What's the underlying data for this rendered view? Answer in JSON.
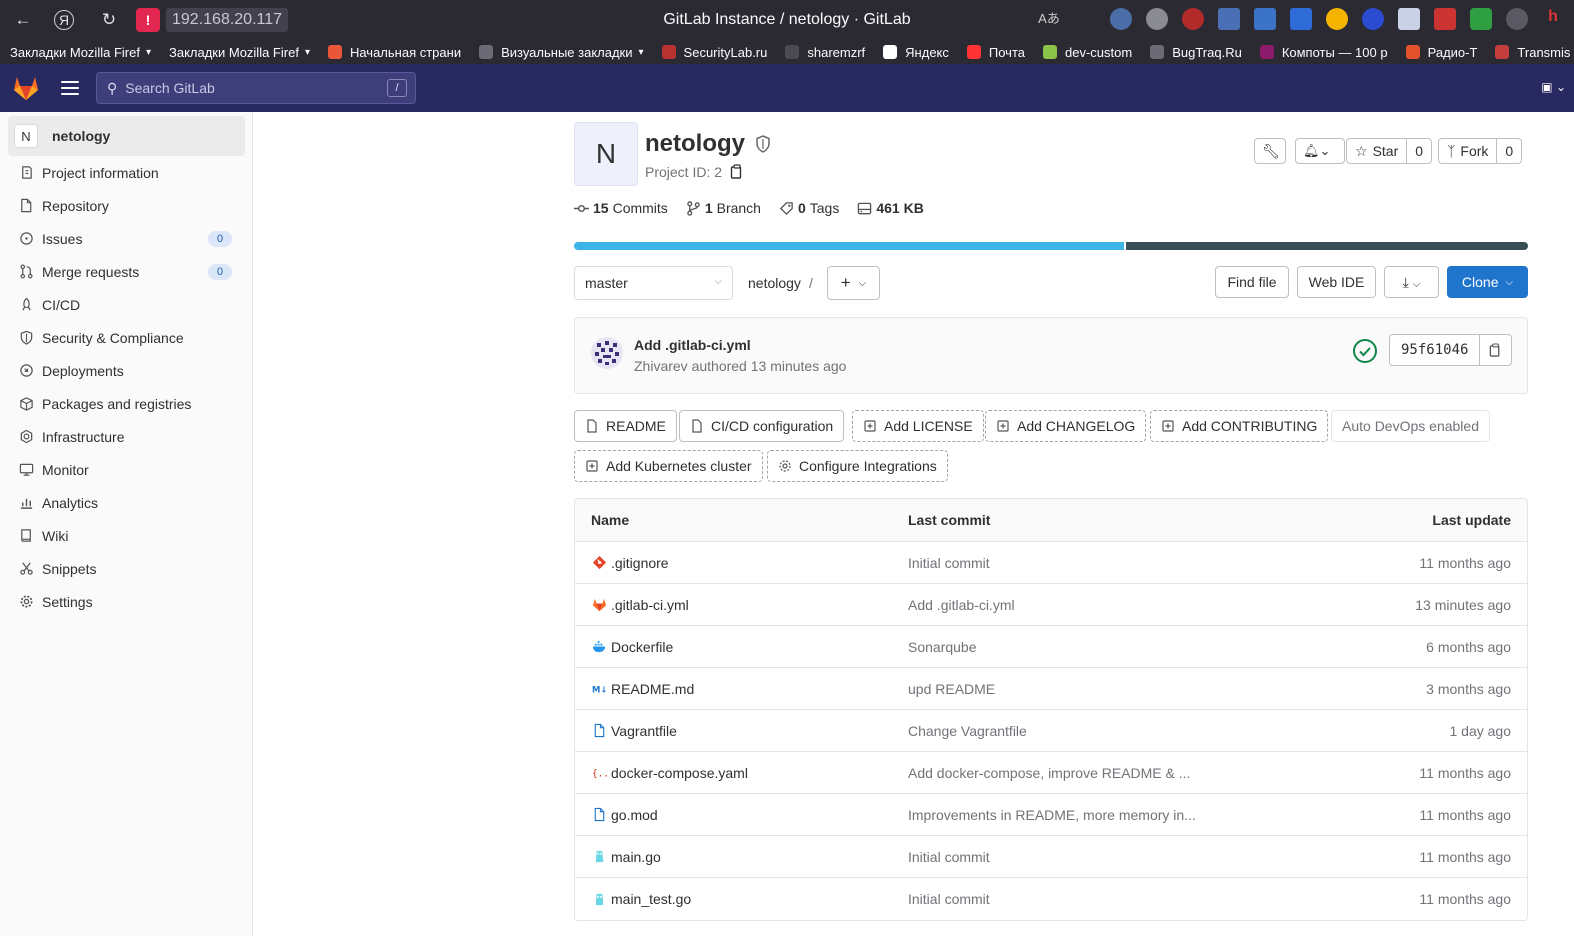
{
  "browser": {
    "url": "192.168.20.117",
    "window_title": "GitLab Instance / netology · GitLab",
    "bookmarks": [
      "Закладки Mozilla Firef",
      "Закладки Mozilla Firef",
      "Начальная страни",
      "Визуальные закладки",
      "SecurityLab.ru",
      "sharemzrf",
      "Яндекс",
      "Почта",
      "dev-custom",
      "BugTraq.Ru",
      "Компоты — 100 р",
      "Радио-Т",
      "Transmis"
    ]
  },
  "header": {
    "search_placeholder": "Search GitLab",
    "search_shortcut": "/"
  },
  "sidebar": {
    "project_letter": "N",
    "project_name": "netology",
    "items": [
      {
        "label": "Project information",
        "icon": "info-icon"
      },
      {
        "label": "Repository",
        "icon": "doc-icon"
      },
      {
        "label": "Issues",
        "icon": "issues-icon",
        "badge": "0"
      },
      {
        "label": "Merge requests",
        "icon": "merge-icon",
        "badge": "0"
      },
      {
        "label": "CI/CD",
        "icon": "rocket-icon"
      },
      {
        "label": "Security & Compliance",
        "icon": "shield-icon"
      },
      {
        "label": "Deployments",
        "icon": "deploy-icon"
      },
      {
        "label": "Packages and registries",
        "icon": "package-icon"
      },
      {
        "label": "Infrastructure",
        "icon": "infra-icon"
      },
      {
        "label": "Monitor",
        "icon": "monitor-icon"
      },
      {
        "label": "Analytics",
        "icon": "chart-icon"
      },
      {
        "label": "Wiki",
        "icon": "book-icon"
      },
      {
        "label": "Snippets",
        "icon": "scissors-icon"
      },
      {
        "label": "Settings",
        "icon": "gear-icon"
      }
    ]
  },
  "project": {
    "letter": "N",
    "name": "netology",
    "id_label": "Project ID: 2",
    "stats": {
      "commits_count": "15",
      "commits_label": "Commits",
      "branches_count": "1",
      "branches_label": "Branch",
      "tags_count": "0",
      "tags_label": "Tags",
      "size": "461 KB"
    },
    "star_label": "Star",
    "star_count": "0",
    "fork_label": "Fork",
    "fork_count": "0",
    "languages": [
      {
        "share": 0.578,
        "color": "#3db5e7"
      },
      {
        "share": 0.422,
        "color": "#384d54"
      }
    ]
  },
  "toolbar": {
    "branch": "master",
    "breadcrumb_root": "netology",
    "breadcrumb_sep": "/",
    "find_file": "Find file",
    "web_ide": "Web IDE",
    "clone": "Clone"
  },
  "last_commit": {
    "title": "Add .gitlab-ci.yml",
    "meta": "Zhivarev authored 13 minutes ago",
    "sha": "95f61046"
  },
  "quick_actions": {
    "readme": "README",
    "cicd": "CI/CD configuration",
    "license": "Add LICENSE",
    "changelog": "Add CHANGELOG",
    "contributing": "Add CONTRIBUTING",
    "autodevops": "Auto DevOps enabled",
    "kubernetes": "Add Kubernetes cluster",
    "integrations": "Configure Integrations"
  },
  "files": {
    "headers": {
      "name": "Name",
      "last_commit": "Last commit",
      "last_update": "Last update"
    },
    "rows": [
      {
        "name": ".gitignore",
        "commit": "Initial commit",
        "updated": "11 months ago",
        "icon": "git-icon"
      },
      {
        "name": ".gitlab-ci.yml",
        "commit": "Add .gitlab-ci.yml",
        "updated": "13 minutes ago",
        "icon": "gitlab-icon"
      },
      {
        "name": "Dockerfile",
        "commit": "Sonarqube",
        "updated": "6 months ago",
        "icon": "docker-icon"
      },
      {
        "name": "README.md",
        "commit": "upd README",
        "updated": "3 months ago",
        "icon": "markdown-icon"
      },
      {
        "name": "Vagrantfile",
        "commit": "Change Vagrantfile",
        "updated": "1 day ago",
        "icon": "file-icon"
      },
      {
        "name": "docker-compose.yaml",
        "commit": "Add docker-compose, improve README & ...",
        "updated": "11 months ago",
        "icon": "yaml-icon"
      },
      {
        "name": "go.mod",
        "commit": "Improvements in README, more memory in...",
        "updated": "11 months ago",
        "icon": "file-icon"
      },
      {
        "name": "main.go",
        "commit": "Initial commit",
        "updated": "11 months ago",
        "icon": "go-icon"
      },
      {
        "name": "main_test.go",
        "commit": "Initial commit",
        "updated": "11 months ago",
        "icon": "go-icon"
      }
    ]
  }
}
